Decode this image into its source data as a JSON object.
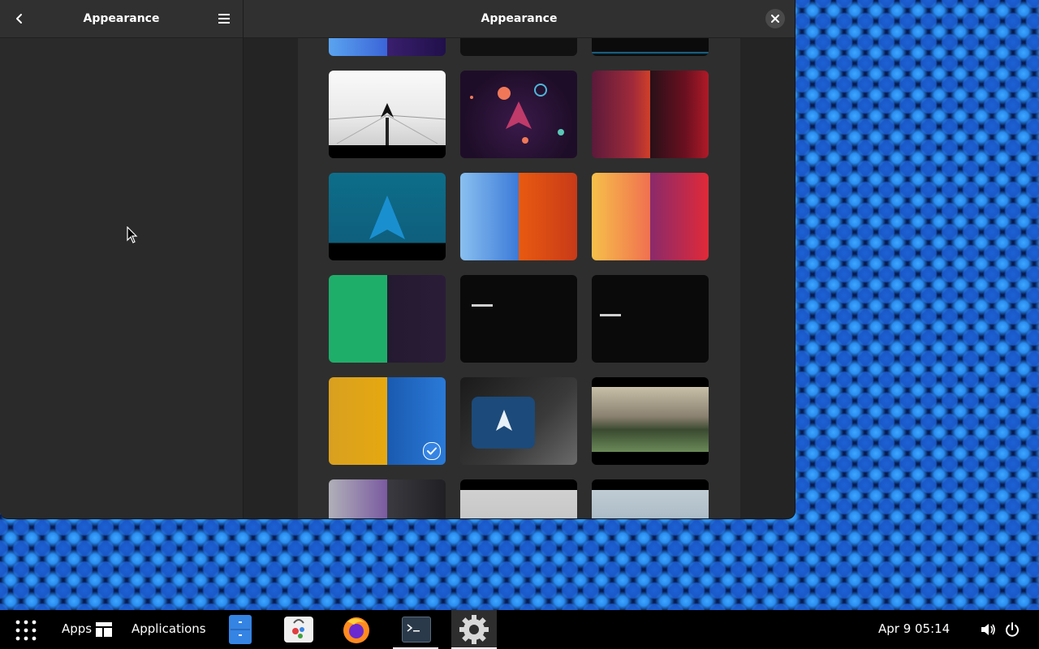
{
  "window": {
    "sidebar_title": "Appearance",
    "main_title": "Appearance"
  },
  "icons": {
    "back": "chevron-left-icon",
    "menu": "hamburger-menu-icon",
    "close": "close-icon",
    "selected": "checkmark-icon"
  },
  "wallpapers": [
    {
      "name": "wallpaper-blue-purple-partial"
    },
    {
      "name": "wallpaper-dark-partial"
    },
    {
      "name": "wallpaper-dark-line-partial"
    },
    {
      "name": "wallpaper-arch-sketch"
    },
    {
      "name": "wallpaper-arch-space"
    },
    {
      "name": "wallpaper-red-layers"
    },
    {
      "name": "wallpaper-arch-blue-logo"
    },
    {
      "name": "wallpaper-drips"
    },
    {
      "name": "wallpaper-sunset-gradient"
    },
    {
      "name": "wallpaper-green-pattern"
    },
    {
      "name": "wallpaper-archlinux-dark-1"
    },
    {
      "name": "wallpaper-archlinux-dark-2"
    },
    {
      "name": "wallpaper-sequins",
      "selected": true
    },
    {
      "name": "wallpaper-arch-device"
    },
    {
      "name": "wallpaper-mountain-lake"
    },
    {
      "name": "wallpaper-colored-scales"
    },
    {
      "name": "wallpaper-grey-fog"
    },
    {
      "name": "wallpaper-snow-mountains"
    }
  ],
  "taskbar": {
    "apps_label": "Apps",
    "applications_label": "Applications",
    "date": "Apr 9",
    "time": "05:14"
  },
  "colors": {
    "accent": "#3584e4",
    "window_bg": "#242424",
    "header_bg": "#303030"
  }
}
